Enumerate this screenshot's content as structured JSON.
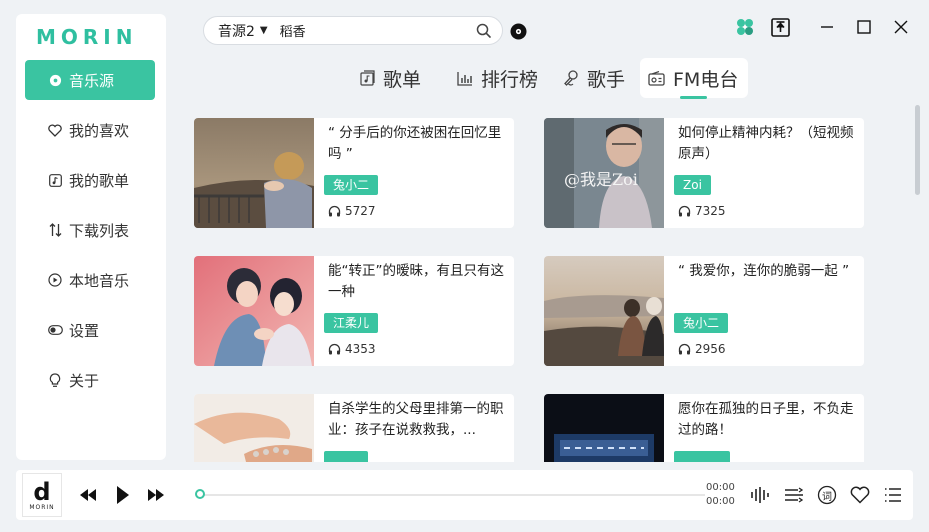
{
  "app": {
    "logo": "MORIN"
  },
  "sidebar": {
    "items": [
      {
        "label": "音乐源",
        "icon": "disc-icon",
        "active": true
      },
      {
        "label": "我的喜欢",
        "icon": "heart-icon"
      },
      {
        "label": "我的歌单",
        "icon": "playlist-icon"
      },
      {
        "label": "下载列表",
        "icon": "download-sort-icon"
      },
      {
        "label": "本地音乐",
        "icon": "local-play-icon"
      },
      {
        "label": "设置",
        "icon": "toggle-icon"
      },
      {
        "label": "关于",
        "icon": "bulb-icon"
      }
    ]
  },
  "search": {
    "source": "音源2",
    "value": "稻香",
    "placeholder": ""
  },
  "tabs": [
    {
      "label": "歌单",
      "icon": "songlist-icon"
    },
    {
      "label": "排行榜",
      "icon": "bar-chart-icon"
    },
    {
      "label": "歌手",
      "icon": "singer-icon"
    },
    {
      "label": "FM电台",
      "icon": "radio-icon",
      "active": true
    }
  ],
  "cards": [
    {
      "title": "“ 分手后的你还被困在回忆里吗 ”",
      "author": "兔小二",
      "plays": "5727"
    },
    {
      "title": "如何停止精神内耗？（短视频原声）",
      "author": "Zoi",
      "plays": "7325",
      "thumb_text": "@我是Zoi"
    },
    {
      "title": "能“转正”的暧昧，有且只有这一种",
      "author": "江柔儿",
      "plays": "4353"
    },
    {
      "title": "“ 我爱你，连你的脆弱一起 ”",
      "author": "兔小二",
      "plays": "2956"
    },
    {
      "title": "自杀学生的父母里排第一的职业：孩子在说救救我，...",
      "author": "",
      "plays": ""
    },
    {
      "title": "愿你在孤独的日子里，不负走过的路！",
      "author": "",
      "plays": ""
    }
  ],
  "player": {
    "cover_letter": "d",
    "cover_text": "MORIN",
    "current_time": "00:00",
    "total_time": "00:00",
    "progress": 0,
    "lyric_label": "词"
  },
  "colors": {
    "accent": "#3ac4a1",
    "background": "#eff2f5"
  }
}
